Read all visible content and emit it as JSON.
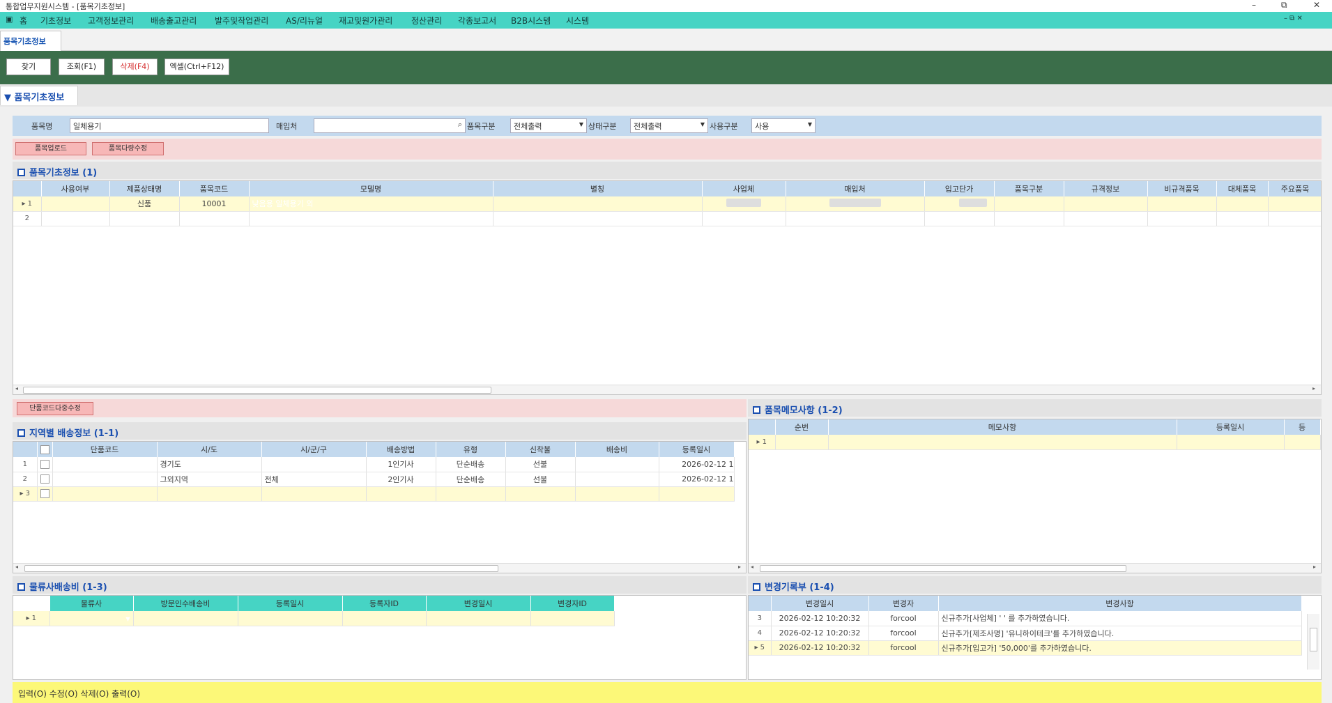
{
  "window": {
    "title": "통합업무지원시스템 - [품목기초정보]",
    "controls": [
      "–",
      "⧉",
      "✕"
    ]
  },
  "menu": {
    "items": [
      "홈",
      "기초정보",
      "고객정보관리",
      "배송출고관리",
      "발주및작업관리",
      "AS/리뉴얼",
      "재고및원가관리",
      "정산관리",
      "각종보고서",
      "B2B시스템",
      "시스템"
    ]
  },
  "tabs": {
    "active": "품목기초정보"
  },
  "toolbar": {
    "find": "찾기",
    "query": "조회(F1)",
    "delete": "삭제(F4)",
    "excel": "엑셀(Ctrl+F12)"
  },
  "section": {
    "title": "▼ 품목기초정보"
  },
  "filters": {
    "item_name_label": "품목명",
    "item_name_value": "일체용기",
    "purchaser_label": "매입처",
    "purchaser_value": "",
    "item_type_label": "품목구분",
    "item_type_value": "전체출력",
    "status_label": "상태구분",
    "status_value": "전체출력",
    "use_label": "사용구분",
    "use_value": "사용"
  },
  "actions": {
    "upload": "품목업로드",
    "bulk_edit": "품목다량수정",
    "unit_code_bulk": "단품코드다중수정"
  },
  "main_grid": {
    "title": "품목기초정보 (1)",
    "columns": [
      "사용여부",
      "제품상태명",
      "품목코드",
      "모델명",
      "별칭",
      "사업체",
      "매입처",
      "입고단가",
      "품목구분",
      "규격정보",
      "비규격품목",
      "대체품목",
      "주요품목"
    ],
    "rows": [
      {
        "num": "1",
        "cells": [
          "",
          "신품",
          "10001",
          "낮음용 일체용기 외",
          "",
          "",
          "",
          "",
          "",
          "",
          "",
          "",
          ""
        ]
      },
      {
        "num": "2",
        "cells": [
          "",
          "",
          "",
          "",
          "",
          "",
          "",
          "",
          "",
          "",
          "",
          "",
          ""
        ]
      }
    ]
  },
  "region_grid": {
    "title": "지역별 배송정보 (1-1)",
    "columns": [
      "단품코드",
      "시/도",
      "시/군/구",
      "배송방법",
      "유형",
      "신착불",
      "배송비",
      "등록일시"
    ],
    "rows": [
      {
        "num": "1",
        "cells": [
          "",
          "경기도",
          "",
          "1인기사",
          "단순배송",
          "선불",
          "",
          "2026-02-12 1"
        ]
      },
      {
        "num": "2",
        "cells": [
          "",
          "그외지역",
          "전체",
          "2인기사",
          "단순배송",
          "선불",
          "",
          "2026-02-12 1"
        ]
      },
      {
        "num": "3",
        "cells": [
          "",
          "",
          "",
          "",
          "",
          "",
          "",
          ""
        ]
      }
    ]
  },
  "memo_grid": {
    "title": "품목메모사항 (1-2)",
    "columns": [
      "순번",
      "메모사항",
      "등록일시",
      "등"
    ],
    "rows": [
      {
        "num": "1",
        "cells": [
          "",
          "",
          "",
          ""
        ]
      }
    ]
  },
  "logistics_grid": {
    "title": "물류사배송비 (1-3)",
    "columns": [
      "물류사",
      "방문인수배송비",
      "등록일시",
      "등록자ID",
      "변경일시",
      "변경자ID"
    ],
    "rows": [
      {
        "num": "1",
        "cells": [
          "",
          "",
          "",
          "",
          "",
          ""
        ]
      }
    ]
  },
  "history_grid": {
    "title": "변경기록부 (1-4)",
    "columns": [
      "변경일시",
      "변경자",
      "변경사항"
    ],
    "rows": [
      {
        "num": "3",
        "cells": [
          "2026-02-12 10:20:32",
          "forcool",
          "신규추가[사업체] '        ' 를 추가하였습니다."
        ]
      },
      {
        "num": "4",
        "cells": [
          "2026-02-12 10:20:32",
          "forcool",
          "신규추가[제조사명] '유니하이테크'를 추가하였습니다."
        ]
      },
      {
        "num": "5",
        "cells": [
          "2026-02-12 10:20:32",
          "forcool",
          "신규추가[입고가] '50,000'를 추가하였습니다."
        ]
      }
    ]
  },
  "status": {
    "text": "입력(O) 수정(O) 삭제(O) 출력(O)"
  },
  "colors": {
    "menubar": "#46d4c4",
    "toolbar": "#3b6e4a",
    "header": "#c3d9ee",
    "selected": "#2e86d8",
    "status": "#fcf878"
  }
}
